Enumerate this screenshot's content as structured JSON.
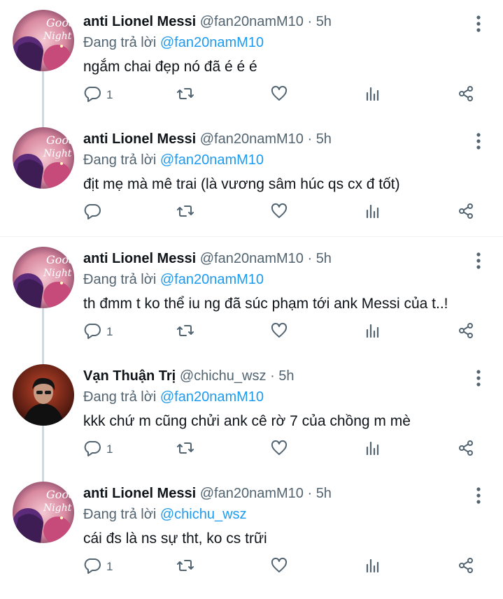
{
  "icons": [
    "reply-icon",
    "retweet-icon",
    "like-icon",
    "analytics-icon",
    "share-icon",
    "more-icon"
  ],
  "colors": {
    "name": "#0f1419",
    "muted": "#536471",
    "mention": "#1d9bf0",
    "thread_line": "#cfd9de"
  },
  "tweets": [
    {
      "name": "anti Lionel Messi",
      "handle": "@fan20namM10",
      "dot": "·",
      "time": "5h",
      "reply_prefix": "Đang trả lời",
      "reply_to": "@fan20namM10",
      "text": "ngắm chai đẹp nó đã é é é",
      "replies": "1",
      "avatar": "anime"
    },
    {
      "name": "anti Lionel Messi",
      "handle": "@fan20namM10",
      "dot": "·",
      "time": "5h",
      "reply_prefix": "Đang trả lời",
      "reply_to": "@fan20namM10",
      "text": "địt mẹ mà mê trai (là vương sâm húc qs cx đ tốt)",
      "replies": "",
      "avatar": "anime"
    },
    {
      "name": "anti Lionel Messi",
      "handle": "@fan20namM10",
      "dot": "·",
      "time": "5h",
      "reply_prefix": "Đang trả lời",
      "reply_to": "@fan20namM10",
      "text": "th đmm t ko thể iu ng đã súc phạm tới ank Messi của t..!",
      "replies": "1",
      "avatar": "anime"
    },
    {
      "name": "Vạn Thuận Trị",
      "handle": "@chichu_wsz",
      "dot": "·",
      "time": "5h",
      "reply_prefix": "Đang trả lời",
      "reply_to": "@fan20namM10",
      "text": "kkk chứ m cũng chửi ank cê rờ 7 của chồng m mè",
      "replies": "1",
      "avatar": "person"
    },
    {
      "name": "anti Lionel Messi",
      "handle": "@fan20namM10",
      "dot": "·",
      "time": "5h",
      "reply_prefix": "Đang trả lời",
      "reply_to": "@chichu_wsz",
      "text": "cái đs là ns sự tht, ko cs trữi",
      "replies": "1",
      "avatar": "anime"
    }
  ]
}
